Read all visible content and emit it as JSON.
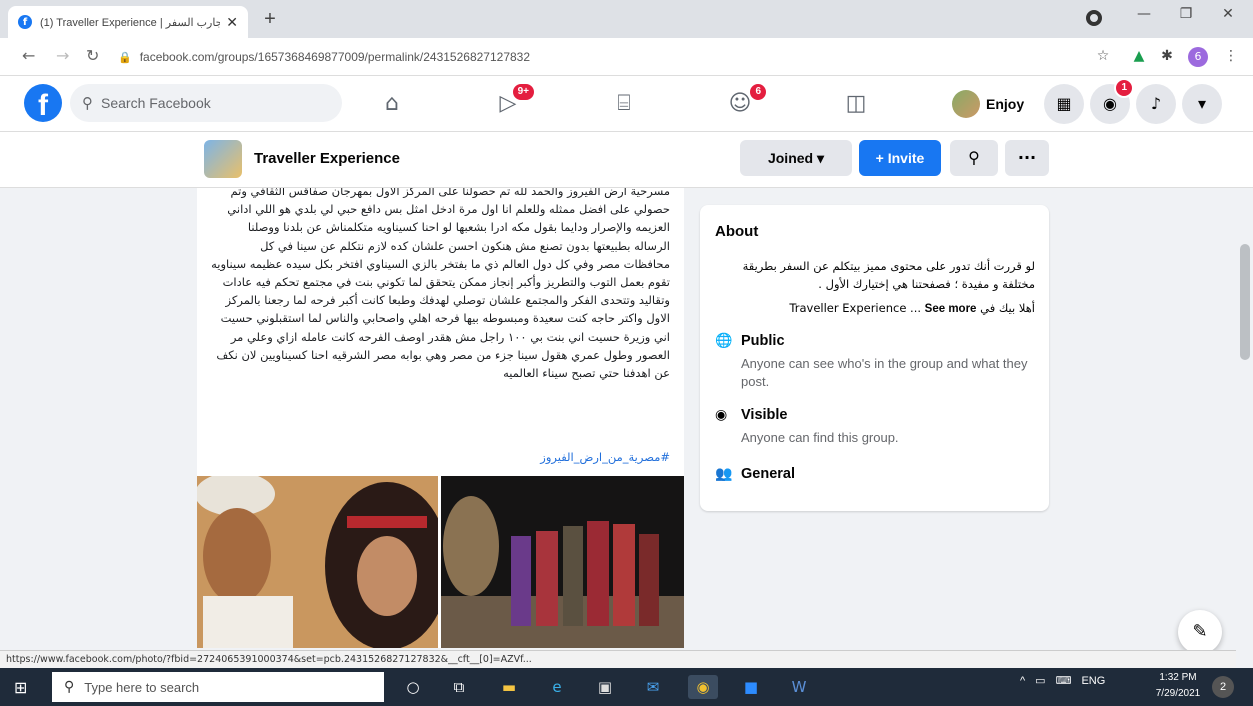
{
  "browser": {
    "tab_title": "(1) Traveller Experience | تجارب السفر",
    "tab_close": "✕",
    "new_tab": "+",
    "url": "facebook.com/groups/1657368469877009/permalink/2431526827127832",
    "window_buttons": [
      "—",
      "❐",
      "✕"
    ]
  },
  "facebook": {
    "search_placeholder": "Search Facebook",
    "watch_badge": "9+",
    "groups_badge": "6",
    "profile_name": "Enjoy",
    "messenger_badge": "1"
  },
  "group": {
    "name": "Traveller Experience",
    "joined_label": "Joined ▾",
    "invite_label": "+ Invite",
    "more_label": "···"
  },
  "post": {
    "text": "مسرحية ارض الفيروز والحمد لله تم حصولنا على المركز الاول بمهرجان صفاقس الثقافي وتم حصولي على افضل ممثله وللعلم انا اول مرة ادخل امثل بس دافع حبي لي بلدي هو اللي اداني العزيمه والإصرار ودايما بقول مكه ادرا بشعبها لو احنا كسيناويه متكلمناش عن بلدنا ووصلنا الرساله بطبيعتها بدون تصنع مش هنكون احسن علشان كده لازم نتكلم عن سينا في كل محافظات مصر وفي كل دول العالم ذي ما بفتخر بالزي السيناوي افتخر بكل سيده عظيمه سيناويه تقوم بعمل التوب والتطريز وأكبر إنجاز ممكن يتحقق لما تكوني بنت في مجتمع تحكم فيه عادات وتقاليد وتتحدى الفكر والمجتمع علشان توصلي لهدفك وطبعا كانت أكبر فرحه لما رجعنا بالمركز الاول واكتر حاجه كنت سعيدة ومبسوطه بيها فرحه اهلي واصحابي والناس لما استقبلوني حسيت اني وزيرة حسيت اني بنت بي ١٠٠ راجل مش هقدر اوصف الفرحه كانت عامله ازاي وعلي مر العصور وطول عمري هقول سينا جزء من مصر وهي بوابه مصر الشرقيه احنا كسيناويين لان نكف عن اهدفنا حتي تصبح سيناء العالميه",
    "hashtag": "#مصرية_من_ارض_الفيروز"
  },
  "about": {
    "title": "About",
    "description": "لو قررت أنك تدور على محتوى مميز بيتكلم عن السفر بطريقة مختلفة و مفيدة ؛ فصفحتنا هي إختيارك الأول .",
    "welcome_prefix": "أهلا بيك في ",
    "welcome_name": "Traveller Experience ... ",
    "see_more": "See more",
    "public_title": "Public",
    "public_desc": "Anyone can see who's in the group and what they post.",
    "visible_title": "Visible",
    "visible_desc": "Anyone can find this group.",
    "general_title": "General"
  },
  "status_link": "https://www.facebook.com/photo/?fbid=2724065391000374&set=pcb.2431526827127832&__cft__[0]=AZVf...",
  "taskbar": {
    "search_placeholder": "Type here to search",
    "language": "ENG",
    "time": "1:32 PM",
    "date": "7/29/2021",
    "notification_count": "2"
  }
}
